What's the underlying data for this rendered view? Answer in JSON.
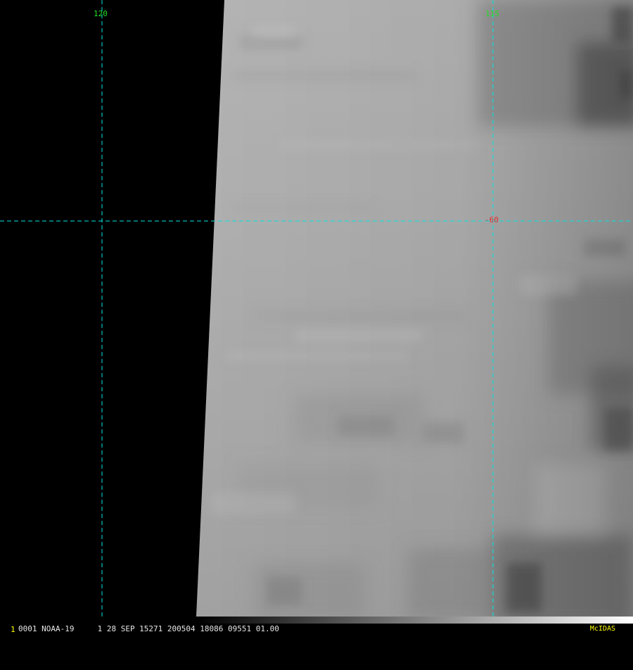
{
  "satellite": "NOAA-19",
  "frame_number": "1",
  "status_line": "0001 NOAA-19     1 28 SEP 15271 200504 18086 09551 01.00",
  "software_label": "McIDAS",
  "grid": {
    "longitude_labels": [
      "120",
      "115"
    ],
    "latitude_labels": [
      "-60"
    ]
  },
  "colors": {
    "background": "#000000",
    "grid_line": "#00e5e5",
    "longitude_label": "#22e022",
    "latitude_label": "#e03030",
    "frame_number": "#ffff00",
    "software_label": "#ffff00",
    "status_text": "#e6e6e6"
  }
}
